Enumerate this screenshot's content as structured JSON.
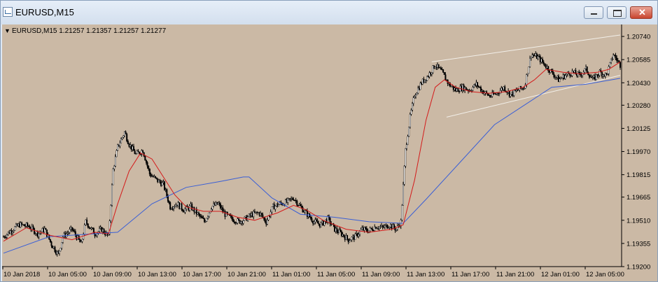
{
  "window": {
    "title": "EURUSD,M15",
    "buttons": {
      "minimize": "",
      "maximize": "",
      "close": "✕"
    }
  },
  "chart_header": {
    "marker": "▼",
    "text": "EURUSD,M15  1.21257 1.21357 1.21257 1.21277"
  },
  "colors": {
    "background": "#cbb9a5",
    "axis": "#000000",
    "ma_fast": "#d41a1a",
    "ma_slow": "#3a5fd6",
    "trendline": "#f2efe9"
  },
  "chart_data": {
    "type": "candlestick",
    "ylim": [
      1.192,
      1.2082
    ],
    "y_ticks": [
      "1.20740",
      "1.20585",
      "1.20430",
      "1.20280",
      "1.20125",
      "1.19970",
      "1.19815",
      "1.19665",
      "1.19510",
      "1.19355",
      "1.19200"
    ],
    "x_ticks": [
      "10 Jan 2018",
      "10 Jan 05:00",
      "10 Jan 09:00",
      "10 Jan 13:00",
      "10 Jan 17:00",
      "10 Jan 21:00",
      "11 Jan 01:00",
      "11 Jan 05:00",
      "11 Jan 09:00",
      "11 Jan 13:00",
      "11 Jan 17:00",
      "11 Jan 21:00",
      "12 Jan 01:00",
      "12 Jan 05:00"
    ],
    "last_bar": {
      "open": 1.21257,
      "high": 1.21357,
      "low": 1.21257,
      "close": 1.21277
    },
    "close_path": [
      [
        0,
        1.194
      ],
      [
        8,
        1.1945
      ],
      [
        14,
        1.1948
      ],
      [
        22,
        1.1947
      ],
      [
        30,
        1.1942
      ],
      [
        36,
        1.1945
      ],
      [
        42,
        1.1935
      ],
      [
        48,
        1.1928
      ],
      [
        52,
        1.194
      ],
      [
        60,
        1.1945
      ],
      [
        68,
        1.1935
      ],
      [
        72,
        1.195
      ],
      [
        80,
        1.1942
      ],
      [
        86,
        1.1945
      ],
      [
        92,
        1.194
      ],
      [
        96,
        1.1985
      ],
      [
        100,
        1.2
      ],
      [
        106,
        1.201
      ],
      [
        110,
        1.2002
      ],
      [
        116,
        1.1995
      ],
      [
        122,
        1.1998
      ],
      [
        128,
        1.1982
      ],
      [
        134,
        1.1978
      ],
      [
        140,
        1.1975
      ],
      [
        146,
        1.196
      ],
      [
        152,
        1.1962
      ],
      [
        158,
        1.1958
      ],
      [
        164,
        1.196
      ],
      [
        170,
        1.1955
      ],
      [
        176,
        1.195
      ],
      [
        182,
        1.196
      ],
      [
        188,
        1.1962
      ],
      [
        194,
        1.1955
      ],
      [
        200,
        1.1952
      ],
      [
        206,
        1.195
      ],
      [
        212,
        1.1952
      ],
      [
        218,
        1.1955
      ],
      [
        224,
        1.1956
      ],
      [
        230,
        1.195
      ],
      [
        236,
        1.196
      ],
      [
        242,
        1.1962
      ],
      [
        248,
        1.1963
      ],
      [
        254,
        1.1966
      ],
      [
        260,
        1.196
      ],
      [
        266,
        1.1955
      ],
      [
        272,
        1.195
      ],
      [
        278,
        1.1948
      ],
      [
        284,
        1.1952
      ],
      [
        290,
        1.1945
      ],
      [
        296,
        1.1942
      ],
      [
        302,
        1.1938
      ],
      [
        308,
        1.194
      ],
      [
        314,
        1.1945
      ],
      [
        320,
        1.1944
      ],
      [
        326,
        1.1947
      ],
      [
        332,
        1.1946
      ],
      [
        338,
        1.1948
      ],
      [
        344,
        1.1945
      ],
      [
        348,
        1.195
      ],
      [
        352,
        1.1998
      ],
      [
        356,
        1.202
      ],
      [
        360,
        1.2035
      ],
      [
        366,
        1.2043
      ],
      [
        372,
        1.2048
      ],
      [
        378,
        1.2055
      ],
      [
        384,
        1.205
      ],
      [
        390,
        1.2042
      ],
      [
        396,
        1.2038
      ],
      [
        402,
        1.204
      ],
      [
        408,
        1.2038
      ],
      [
        414,
        1.2042
      ],
      [
        420,
        1.2037
      ],
      [
        426,
        1.2034
      ],
      [
        432,
        1.2036
      ],
      [
        438,
        1.204
      ],
      [
        444,
        1.2035
      ],
      [
        450,
        1.2038
      ],
      [
        456,
        1.204
      ],
      [
        462,
        1.2062
      ],
      [
        468,
        1.206
      ],
      [
        474,
        1.2055
      ],
      [
        480,
        1.205
      ],
      [
        486,
        1.2045
      ],
      [
        492,
        1.2048
      ],
      [
        498,
        1.205
      ],
      [
        504,
        1.2048
      ],
      [
        510,
        1.2052
      ],
      [
        516,
        1.2045
      ],
      [
        522,
        1.205
      ],
      [
        528,
        1.2048
      ],
      [
        534,
        1.2062
      ],
      [
        540,
        1.2055
      ]
    ],
    "ma_fast": [
      [
        0,
        1.1937
      ],
      [
        20,
        1.1946
      ],
      [
        40,
        1.1941
      ],
      [
        60,
        1.1938
      ],
      [
        80,
        1.1943
      ],
      [
        92,
        1.1942
      ],
      [
        100,
        1.1962
      ],
      [
        110,
        1.1984
      ],
      [
        120,
        1.1996
      ],
      [
        130,
        1.1992
      ],
      [
        140,
        1.198
      ],
      [
        150,
        1.1968
      ],
      [
        160,
        1.196
      ],
      [
        175,
        1.1957
      ],
      [
        190,
        1.1957
      ],
      [
        205,
        1.1953
      ],
      [
        220,
        1.1951
      ],
      [
        240,
        1.1956
      ],
      [
        254,
        1.1961
      ],
      [
        265,
        1.1958
      ],
      [
        280,
        1.1951
      ],
      [
        300,
        1.1945
      ],
      [
        320,
        1.1943
      ],
      [
        340,
        1.1945
      ],
      [
        350,
        1.1948
      ],
      [
        360,
        1.1978
      ],
      [
        370,
        1.2018
      ],
      [
        378,
        1.204
      ],
      [
        386,
        1.2045
      ],
      [
        396,
        1.204
      ],
      [
        410,
        1.2037
      ],
      [
        425,
        1.2036
      ],
      [
        440,
        1.2037
      ],
      [
        455,
        1.204
      ],
      [
        465,
        1.2045
      ],
      [
        475,
        1.2052
      ],
      [
        490,
        1.205
      ],
      [
        505,
        1.2049
      ],
      [
        520,
        1.205
      ],
      [
        530,
        1.2052
      ],
      [
        540,
        1.2057
      ]
    ],
    "ma_slow": [
      [
        0,
        1.1929
      ],
      [
        40,
        1.194
      ],
      [
        80,
        1.1942
      ],
      [
        100,
        1.1943
      ],
      [
        130,
        1.1962
      ],
      [
        160,
        1.1973
      ],
      [
        190,
        1.1977
      ],
      [
        210,
        1.198
      ],
      [
        215,
        1.198
      ],
      [
        235,
        1.1966
      ],
      [
        260,
        1.1955
      ],
      [
        290,
        1.1953
      ],
      [
        320,
        1.195
      ],
      [
        350,
        1.1949
      ],
      [
        370,
        1.1965
      ],
      [
        400,
        1.199
      ],
      [
        430,
        1.2015
      ],
      [
        460,
        1.203
      ],
      [
        480,
        1.204
      ],
      [
        510,
        1.2042
      ],
      [
        540,
        1.2046
      ]
    ],
    "trendlines": [
      {
        "from": [
          375,
          1.2057
        ],
        "to": [
          540,
          1.2075
        ]
      },
      {
        "from": [
          388,
          1.202
        ],
        "to": [
          540,
          1.2048
        ]
      }
    ]
  }
}
